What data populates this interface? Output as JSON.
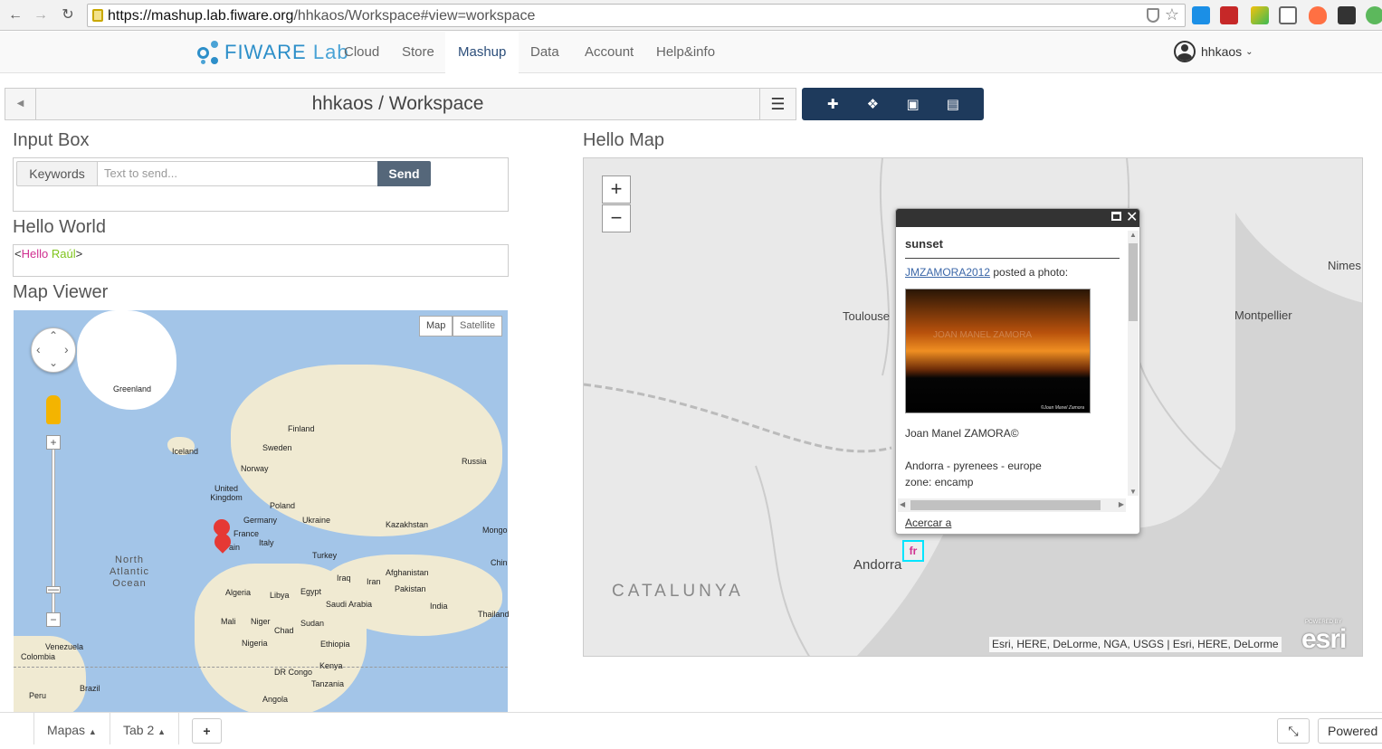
{
  "browser": {
    "url_host": "https://mashup.lab.fiware.org",
    "url_path": "/hhkaos/Workspace#view=workspace"
  },
  "nav": {
    "logo_part1": "FIWARE",
    "logo_part2": " Lab",
    "items": [
      "Cloud",
      "Store",
      "Mashup",
      "Data",
      "Account",
      "Help&info"
    ],
    "active": "Mashup",
    "user": "hhkaos"
  },
  "workspace": {
    "title": "hhkaos / Workspace"
  },
  "input_box": {
    "title": "Input Box",
    "keywords_label": "Keywords",
    "placeholder": "Text to send...",
    "send_label": "Send"
  },
  "hello_world": {
    "title": "Hello World",
    "open": "<",
    "word1": "Hello",
    "word2": "Raúl",
    "close": ">"
  },
  "map_viewer": {
    "title": "Map Viewer",
    "map_btn": "Map",
    "sat_btn": "Satellite",
    "labels": [
      "Greenland",
      "Iceland",
      "Sweden",
      "Finland",
      "Norway",
      "United Kingdom",
      "Poland",
      "Russia",
      "Germany",
      "Ukraine",
      "Kazakhstan",
      "Mongo",
      "France",
      "Italy",
      "Turkey",
      "Chin",
      "North Atlantic Ocean",
      "Iraq",
      "Iran",
      "Afghanistan",
      "Algeria",
      "Libya",
      "Egypt",
      "Saudi Arabia",
      "Pakistan",
      "India",
      "Thailand",
      "Mali",
      "Niger",
      "Chad",
      "Sudan",
      "Nigeria",
      "Ethiopia",
      "Venezuela",
      "Colombia",
      "DR Congo",
      "Kenya",
      "Tanzania",
      "Brazil",
      "Peru",
      "Angola",
      "ain"
    ]
  },
  "hello_map": {
    "title": "Hello Map",
    "places": [
      "Toulouse",
      "Montpellier",
      "Nimes",
      "Andorra",
      "CATALUNYA"
    ],
    "attribution": "Esri, HERE, DeLorme, NGA, USGS | Esri, HERE, DeLorme",
    "powered_by": "POWERED BY",
    "esri_logo": "esri",
    "popup": {
      "title": "sunset",
      "user_link": "JMZAMORA2012",
      "posted": " posted a photo:",
      "photo_watermark": "JOAN MANEL ZAMORA",
      "photo_signature": "©Joan Manel Zamora",
      "author": "Joan Manel ZAMORA©",
      "tags": "Andorra - pyrenees - europe",
      "zone": "zone: encamp",
      "zoom_link": "Acercar a"
    },
    "marker_text": "fr"
  },
  "tabs": {
    "items": [
      "Mapas",
      "Tab 2"
    ],
    "add": "+",
    "powered": "Powered"
  }
}
